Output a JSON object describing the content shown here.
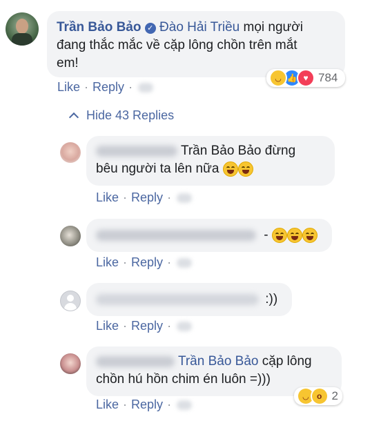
{
  "comment": {
    "author": "Trần Bảo Bảo",
    "tagged": "Đào Hải Triều",
    "text_line1": "mọi người",
    "text_line2": "đang thắc mắc về cặp lông chồn trên mắt",
    "text_line3": "em!",
    "like": "Like",
    "reply": "Reply",
    "reaction_count": "784"
  },
  "hide_replies": "Hide 43 Replies",
  "replies": [
    {
      "line1": "Trần Bảo Bảo đừng",
      "line2": "bêu người ta lên nữa",
      "like": "Like",
      "reply": "Reply"
    },
    {
      "line1": "-",
      "like": "Like",
      "reply": "Reply"
    },
    {
      "line1": ":))",
      "like": "Like",
      "reply": "Reply"
    },
    {
      "tag": "Trần Bảo Bảo",
      "line1": "cặp lông",
      "line2": "chồn hú hồn chim én luôn =)))",
      "like": "Like",
      "reply": "Reply",
      "reaction_count": "2"
    }
  ],
  "colors": {
    "link": "#385898",
    "bubble": "#f2f3f5",
    "verified": "#4267b2"
  }
}
